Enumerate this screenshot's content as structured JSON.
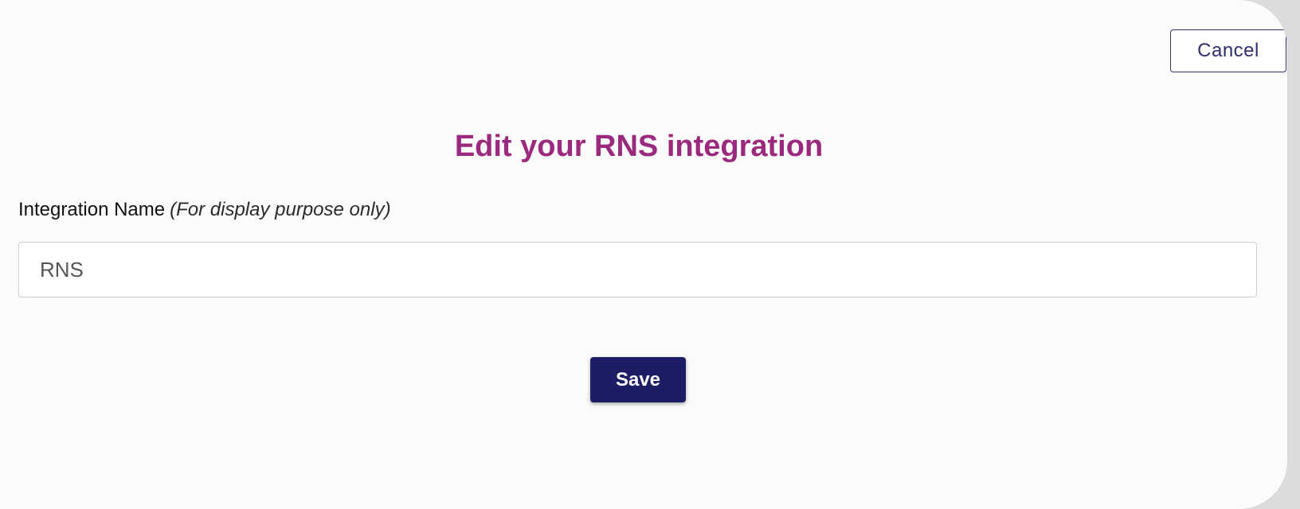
{
  "header": {
    "cancel_label": "Cancel"
  },
  "form": {
    "title": "Edit your RNS integration",
    "integration_name": {
      "label": "Integration Name",
      "note": "(For display purpose only)",
      "value": "RNS"
    },
    "save_label": "Save"
  },
  "colors": {
    "title": "#9b2a7e",
    "primary": "#1d1d66",
    "cancel_border": "#2e2f6e",
    "background": "#fbfbfc"
  }
}
